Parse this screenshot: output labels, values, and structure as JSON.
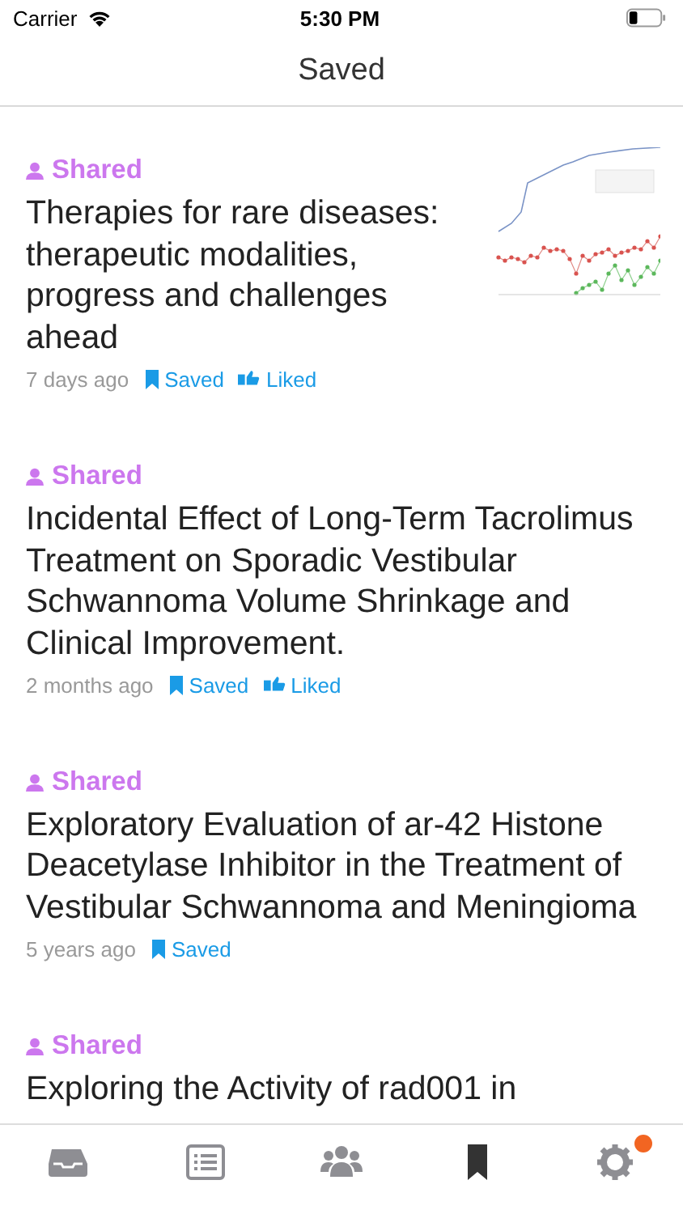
{
  "status_bar": {
    "carrier": "Carrier",
    "time": "5:30 PM"
  },
  "nav": {
    "title": "Saved"
  },
  "articles": [
    {
      "shared_label": "Shared",
      "title": "Therapies for rare diseases: therapeutic modalities, progress and challenges ahead",
      "age": "7 days ago",
      "saved": true,
      "saved_label": "Saved",
      "liked": true,
      "liked_label": "Liked",
      "thumbnail": {
        "kind": "chart"
      }
    },
    {
      "shared_label": "Shared",
      "title": "Incidental Effect of Long-Term Tacrolimus Treatment on Sporadic Vestibular Schwannoma Volume Shrinkage and Clinical Improvement.",
      "age": "2 months ago",
      "saved": true,
      "saved_label": "Saved",
      "liked": true,
      "liked_label": "Liked"
    },
    {
      "shared_label": "Shared",
      "title": "Exploratory Evaluation of ar-42 Histone Deacetylase Inhibitor in the Treatment of Vestibular Schwannoma and Meningioma",
      "age": "5 years ago",
      "saved": true,
      "saved_label": "Saved",
      "liked": false
    },
    {
      "shared_label": "Shared",
      "title": "Exploring the Activity of rad001 in"
    }
  ],
  "tabs": [
    {
      "kind": "inbox",
      "selected": false
    },
    {
      "kind": "list",
      "selected": false
    },
    {
      "kind": "people",
      "selected": false
    },
    {
      "kind": "bookmark",
      "selected": true
    },
    {
      "kind": "settings",
      "selected": false,
      "badge": true
    }
  ]
}
